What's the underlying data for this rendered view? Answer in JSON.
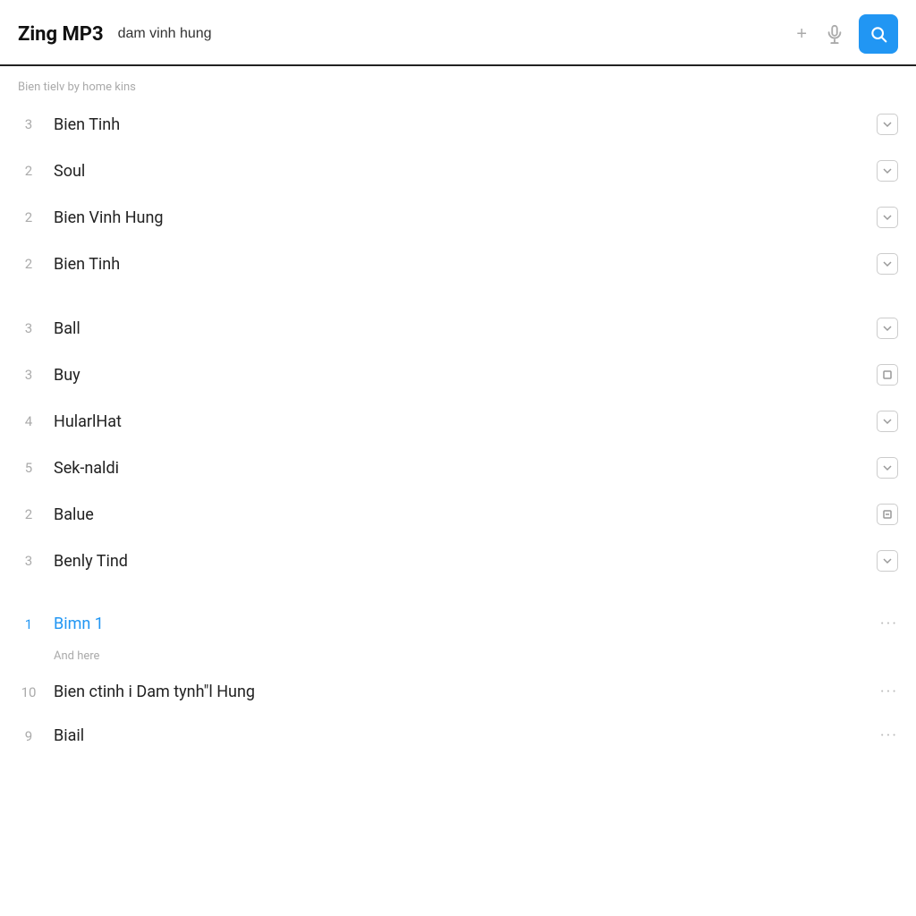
{
  "header": {
    "app_title": "Zing MP3",
    "search_value": "dam vinh hung",
    "search_placeholder": "dam vinh hung",
    "add_icon": "+",
    "mic_icon": "🎤",
    "search_icon": "🔍"
  },
  "sections": [
    {
      "id": "section1",
      "label": "Bien tielv by home kins",
      "items": [
        {
          "rank": "3",
          "title": "Bien Tinh",
          "action": "chevron",
          "highlight": false
        },
        {
          "rank": "2",
          "title": "Soul",
          "action": "chevron",
          "highlight": false
        },
        {
          "rank": "2",
          "title": "Bien Vinh Hung",
          "action": "chevron",
          "highlight": false
        },
        {
          "rank": "2",
          "title": "Bien Tinh",
          "action": "chevron",
          "highlight": false
        }
      ]
    },
    {
      "id": "section2",
      "label": "",
      "items": [
        {
          "rank": "3",
          "title": "Ball",
          "action": "chevron",
          "highlight": false
        },
        {
          "rank": "3",
          "title": "Buy",
          "action": "square",
          "highlight": false
        },
        {
          "rank": "4",
          "title": "HularlHat",
          "action": "chevron",
          "highlight": false
        },
        {
          "rank": "5",
          "title": "Sek-naldi",
          "action": "chevron",
          "highlight": false
        },
        {
          "rank": "2",
          "title": "Balue",
          "action": "square2",
          "highlight": false
        },
        {
          "rank": "3",
          "title": "Benly Tind",
          "action": "chevron",
          "highlight": false
        }
      ]
    },
    {
      "id": "section3",
      "label": "",
      "items": [
        {
          "rank": "1",
          "title": "Bimn 1",
          "action": "dots",
          "highlight": true,
          "sub_label": "And here"
        },
        {
          "rank": "10",
          "title": "Bien ctinh i Dam tynh\"l Hung",
          "action": "dots",
          "highlight": false
        },
        {
          "rank": "9",
          "title": "Biail",
          "action": "dots",
          "highlight": false
        }
      ]
    }
  ]
}
